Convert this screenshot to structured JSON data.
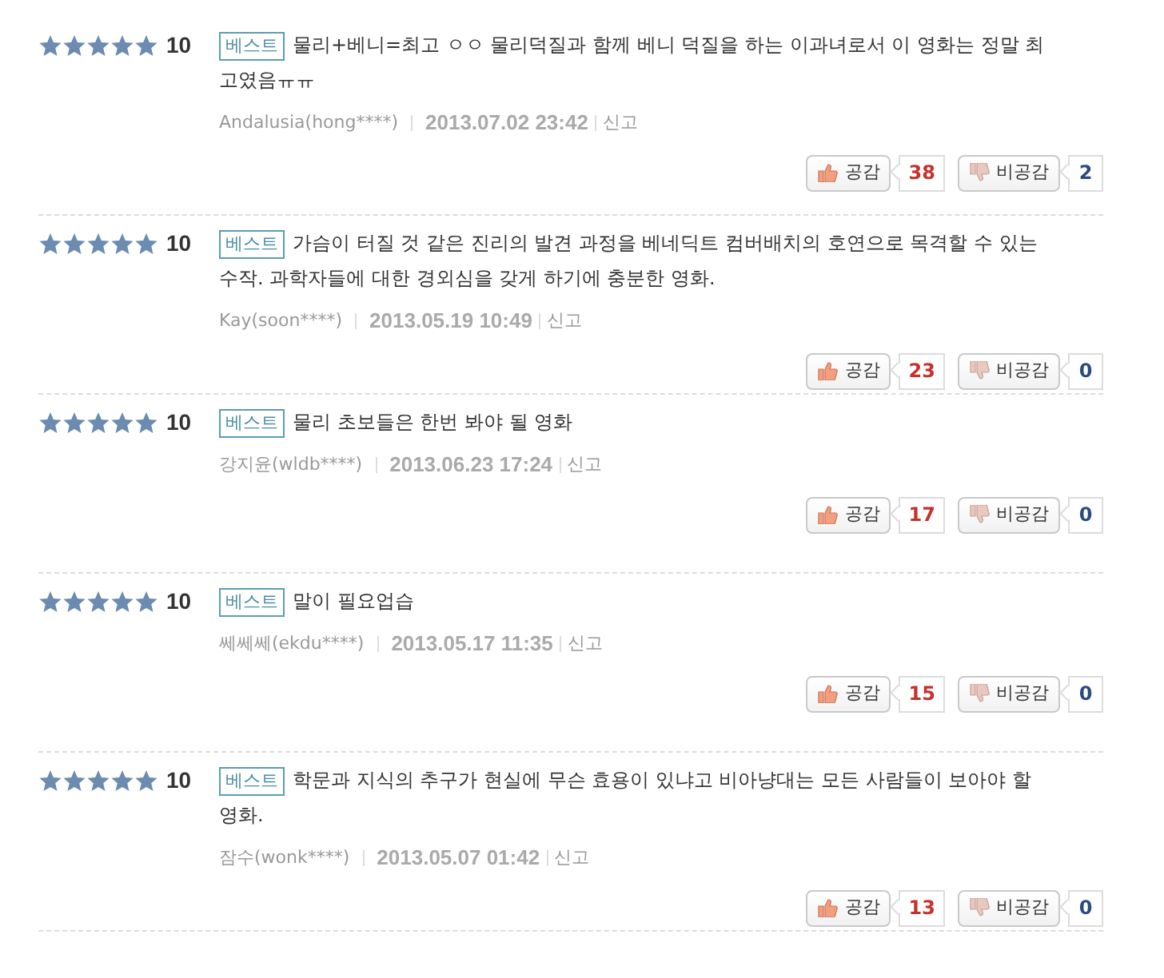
{
  "reviews": [
    {
      "stars": 5,
      "score": "10",
      "badge": "베스트",
      "text": "물리+베니=최고 ㅇㅇ 물리덕질과 함께 베니 덕질을 하는 이과녀로서 이 영화는 정말 최고였음ㅠㅠ",
      "author": "Andalusia(hong****)",
      "date": "2013.07.02 23:42",
      "report": "신고",
      "like_label": "공감",
      "likes": "38",
      "dislike_label": "비공감",
      "dislikes": "2"
    },
    {
      "stars": 5,
      "score": "10",
      "badge": "베스트",
      "text": "가슴이 터질 것 같은 진리의 발견 과정을 베네딕트 컴버배치의 호연으로 목격할 수 있는 수작. 과학자들에 대한 경외심을 갖게 하기에 충분한 영화.",
      "author": "Kay(soon****)",
      "date": "2013.05.19 10:49",
      "report": "신고",
      "like_label": "공감",
      "likes": "23",
      "dislike_label": "비공감",
      "dislikes": "0"
    },
    {
      "stars": 5,
      "score": "10",
      "badge": "베스트",
      "text": "물리 초보들은 한번 봐야 될 영화",
      "author": "강지윤(wldb****)",
      "date": "2013.06.23 17:24",
      "report": "신고",
      "like_label": "공감",
      "likes": "17",
      "dislike_label": "비공감",
      "dislikes": "0"
    },
    {
      "stars": 5,
      "score": "10",
      "badge": "베스트",
      "text": "말이 필요업습",
      "author": "쎄쎄쎄(ekdu****)",
      "date": "2013.05.17 11:35",
      "report": "신고",
      "like_label": "공감",
      "likes": "15",
      "dislike_label": "비공감",
      "dislikes": "0"
    },
    {
      "stars": 5,
      "score": "10",
      "badge": "베스트",
      "text": "학문과 지식의 추구가 현실에 무슨 효용이 있냐고 비아냥대는 모든 사람들이 보아야 할 영화.",
      "author": "잠수(wonk****)",
      "date": "2013.05.07 01:42",
      "report": "신고",
      "like_label": "공감",
      "likes": "13",
      "dislike_label": "비공감",
      "dislikes": "0"
    }
  ]
}
